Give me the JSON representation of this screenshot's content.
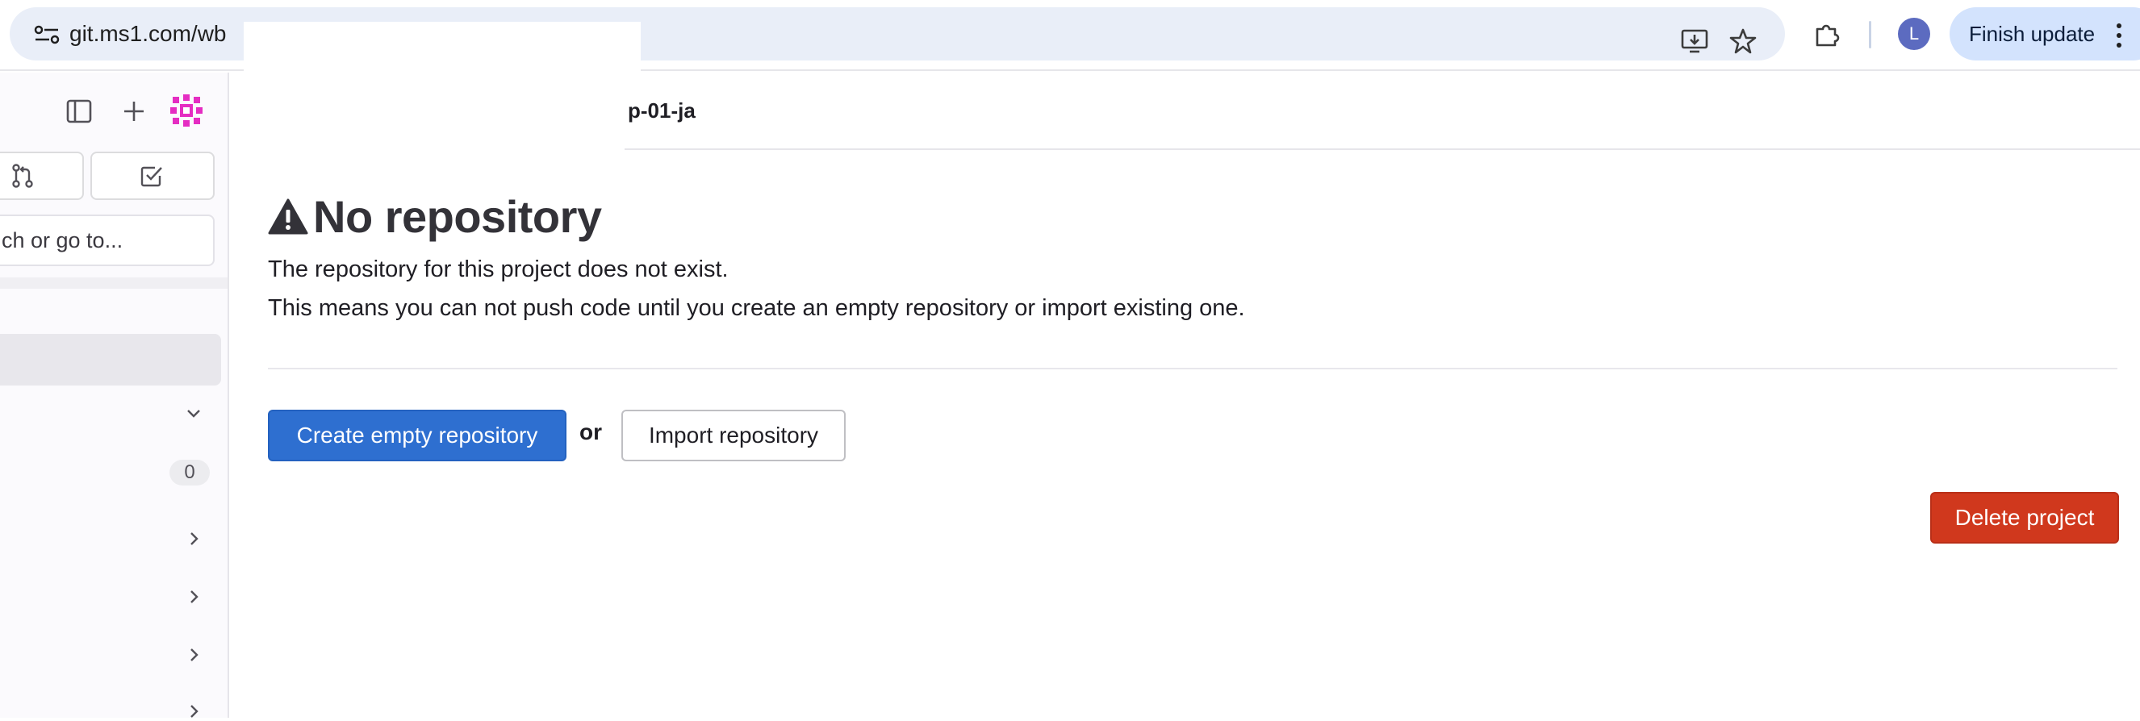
{
  "browser": {
    "url": "git.ms1.com/wb",
    "profile_initial": "L",
    "finish_update_label": "Finish update"
  },
  "sidebar": {
    "search_placeholder": "ch or go to...",
    "badge_count": "0"
  },
  "breadcrumb": {
    "current": "p-01-ja"
  },
  "main": {
    "title": "No repository",
    "desc_line1": "The repository for this project does not exist.",
    "desc_line2": "This means you can not push code until you create an empty repository or import existing one.",
    "create_button": "Create empty repository",
    "or_text": "or",
    "import_button": "Import repository",
    "delete_button": "Delete project"
  },
  "colors": {
    "primary": "#2e6fd0",
    "danger": "#d0381d",
    "logo": "#e52dc2"
  }
}
